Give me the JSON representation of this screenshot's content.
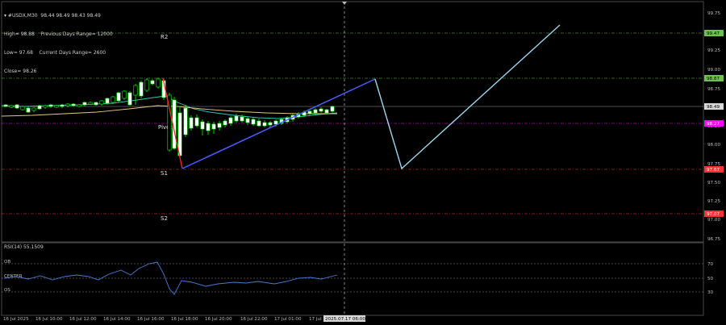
{
  "header": {
    "symbol_line": "▾ #USDX,M30  98.44 98.49 98.43 98.49",
    "line2": "High= 98.88    Previous Days Range= 12000",
    "line3": "Low= 97.68    Current Days Range= 2600",
    "line4": "Close= 98.26"
  },
  "levels": {
    "r2": "R2",
    "pivot": "Pivot",
    "s1": "S1",
    "s2": "S2"
  },
  "price_axis": {
    "ticks": [
      "99.75",
      "99.50",
      "99.25",
      "99.00",
      "98.75",
      "98.50",
      "98.25",
      "98.00",
      "97.75",
      "97.50",
      "97.25",
      "97.00",
      "96.75"
    ],
    "tag_r2": "99.47",
    "tag_r1": "98.87",
    "tag_current": "98.49",
    "tag_pivot": "98.27",
    "tag_s1": "97.67",
    "tag_s2": "97.07"
  },
  "rsi": {
    "title": "RSI(14) 55.1509",
    "label_ob": "OB",
    "label_center": "CENTER",
    "label_os": "OS",
    "ticks": [
      "70",
      "50",
      "30"
    ]
  },
  "time_axis": {
    "labels": [
      "16 Jul 2025",
      "16 Jul 10:00",
      "16 Jul 12:00",
      "16 Jul 14:00",
      "16 Jul 16:00",
      "16 Jul 18:00",
      "16 Jul 20:00",
      "16 Jul 22:00",
      "17 Jul 01:00",
      "17 Jul"
    ],
    "crosshair_label": "2025.07.17 06:00"
  },
  "colors": {
    "background": "#000000",
    "bull_candle": "#ffffff",
    "bear_candle": "#000000",
    "candle_outline": "#00ff00",
    "ma_fast": "#2ec6b5",
    "ma_slow": "#e8c87a",
    "trend_blue": "#4a5cff",
    "trend_red": "#ff2a2a",
    "projection": "#9ad7f0",
    "green_level": "#6cc34a",
    "red_level": "#ff3030",
    "pivot_level": "#ff00ff",
    "rsi_line": "#4a7bd8"
  }
}
